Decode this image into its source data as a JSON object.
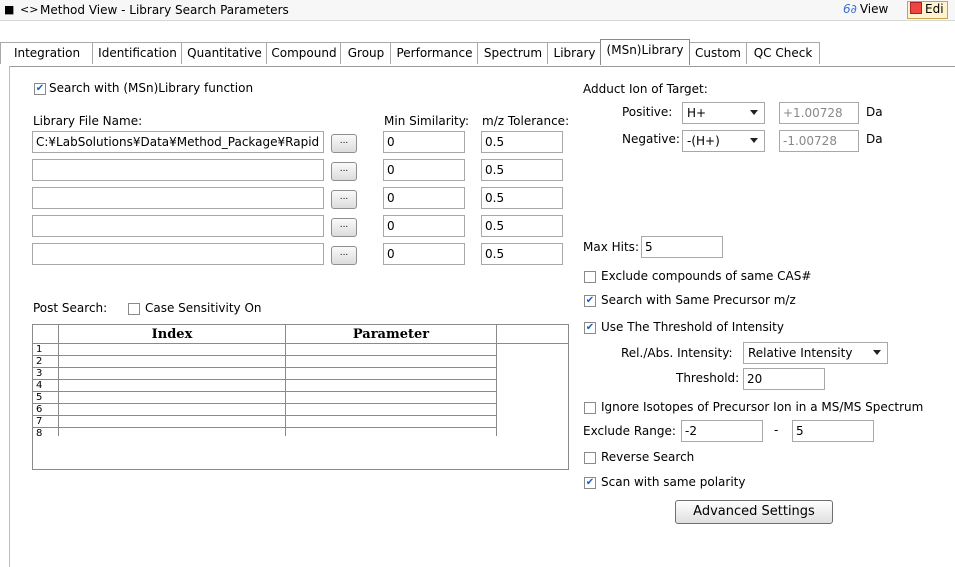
{
  "window": {
    "title": "Method View - Library Search Parameters",
    "view_label": "View",
    "edit_label": "Edi"
  },
  "tabs": [
    "Integration",
    "Identification",
    "Quantitative",
    "Compound",
    "Group",
    "Performance",
    "Spectrum",
    "Library",
    "(MSn)Library",
    "Custom",
    "QC Check"
  ],
  "active_tab": "(MSn)Library",
  "left": {
    "search_msn_label": "Search with (MSn)Library function",
    "search_msn_checked": true,
    "library_file_label": "Library File Name:",
    "min_similarity_label": "Min Similarity:",
    "mz_tolerance_label": "m/z Tolerance:",
    "browse_label": "...",
    "rows": [
      {
        "file": "C:¥LabSolutions¥Data¥Method_Package¥Rapid T",
        "similarity": "0",
        "tolerance": "0.5"
      },
      {
        "file": "",
        "similarity": "0",
        "tolerance": "0.5"
      },
      {
        "file": "",
        "similarity": "0",
        "tolerance": "0.5"
      },
      {
        "file": "",
        "similarity": "0",
        "tolerance": "0.5"
      },
      {
        "file": "",
        "similarity": "0",
        "tolerance": "0.5"
      }
    ],
    "post_search_label": "Post Search:",
    "case_sensitivity_label": "Case Sensitivity On",
    "case_sensitivity_checked": false,
    "grid": {
      "columns": [
        "Index",
        "Parameter"
      ],
      "row_numbers": [
        "1",
        "2",
        "3",
        "4",
        "5",
        "6",
        "7",
        "8"
      ]
    }
  },
  "right": {
    "adduct_label": "Adduct Ion of Target:",
    "positive_label": "Positive:",
    "positive_value": "H+",
    "positive_mass": "+1.00728",
    "negative_label": "Negative:",
    "negative_value": "-(H+)",
    "negative_mass": "-1.00728",
    "unit": "Da",
    "max_hits_label": "Max Hits:",
    "max_hits_value": "5",
    "exclude_cas_label": "Exclude compounds of same CAS#",
    "exclude_cas_checked": false,
    "same_precursor_label": "Search with Same Precursor m/z",
    "same_precursor_checked": true,
    "use_threshold_label": "Use The Threshold of Intensity",
    "use_threshold_checked": true,
    "rel_abs_label": "Rel./Abs. Intensity:",
    "rel_abs_value": "Relative Intensity",
    "threshold_label": "Threshold:",
    "threshold_value": "20",
    "ignore_isotopes_label": "Ignore Isotopes of Precursor Ion in a MS/MS Spectrum",
    "ignore_isotopes_checked": false,
    "exclude_range_label": "Exclude Range:",
    "exclude_range_from": "-2",
    "range_sep": "-",
    "exclude_range_to": "5",
    "reverse_search_label": "Reverse Search",
    "reverse_search_checked": false,
    "scan_polarity_label": "Scan with same polarity",
    "scan_polarity_checked": true,
    "advanced_label": "Advanced Settings"
  }
}
